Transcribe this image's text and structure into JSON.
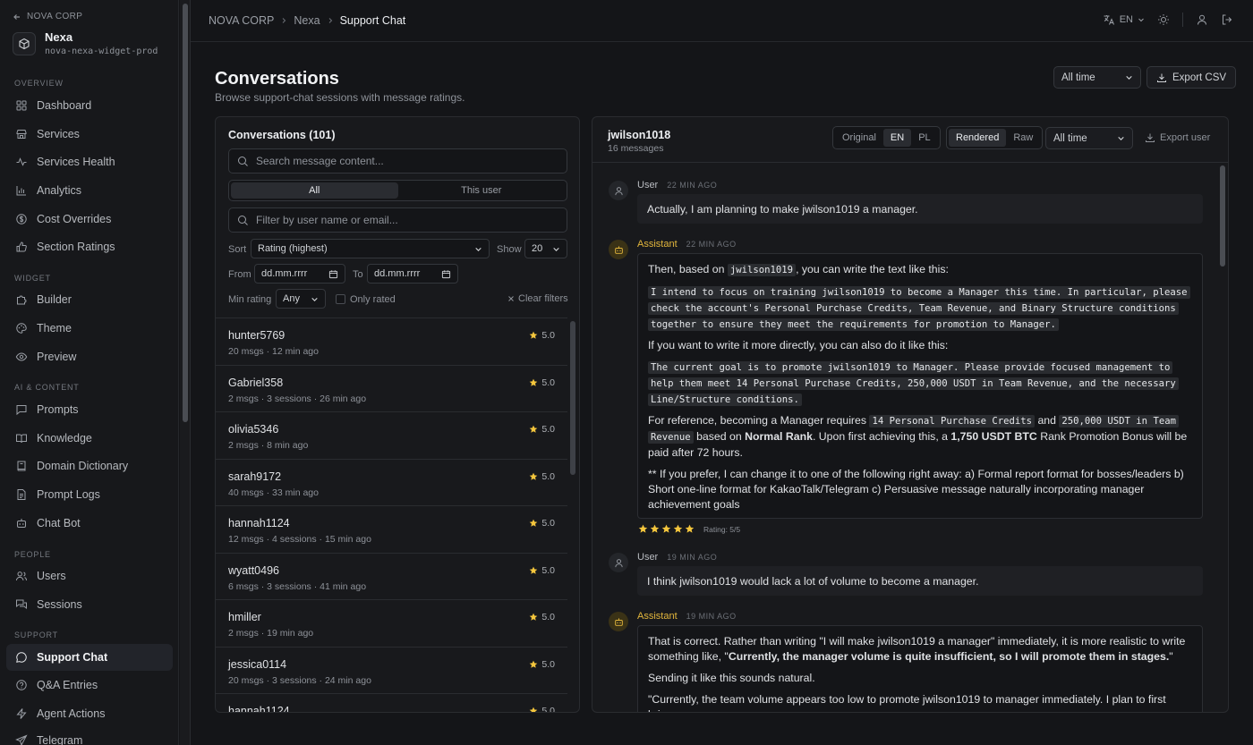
{
  "sidebar": {
    "back_label": "NOVA CORP",
    "project_name": "Nexa",
    "project_id": "nova-nexa-widget-prod",
    "sections": [
      {
        "title": "OVERVIEW",
        "items": [
          {
            "label": "Dashboard",
            "icon": "layout-grid-icon"
          },
          {
            "label": "Services",
            "icon": "store-icon"
          },
          {
            "label": "Services Health",
            "icon": "activity-icon"
          },
          {
            "label": "Analytics",
            "icon": "bar-chart-icon"
          },
          {
            "label": "Cost Overrides",
            "icon": "dollar-circle-icon"
          },
          {
            "label": "Section Ratings",
            "icon": "thumbs-up-icon"
          }
        ]
      },
      {
        "title": "WIDGET",
        "items": [
          {
            "label": "Builder",
            "icon": "puzzle-icon"
          },
          {
            "label": "Theme",
            "icon": "palette-icon"
          },
          {
            "label": "Preview",
            "icon": "eye-icon"
          }
        ]
      },
      {
        "title": "AI & CONTENT",
        "items": [
          {
            "label": "Prompts",
            "icon": "message-square-icon"
          },
          {
            "label": "Knowledge",
            "icon": "book-open-icon"
          },
          {
            "label": "Domain Dictionary",
            "icon": "book-icon"
          },
          {
            "label": "Prompt Logs",
            "icon": "file-text-icon"
          },
          {
            "label": "Chat Bot",
            "icon": "bot-icon"
          }
        ]
      },
      {
        "title": "PEOPLE",
        "items": [
          {
            "label": "Users",
            "icon": "users-icon"
          },
          {
            "label": "Sessions",
            "icon": "messages-icon"
          }
        ]
      },
      {
        "title": "SUPPORT",
        "items": [
          {
            "label": "Support Chat",
            "icon": "message-circle-icon",
            "active": true
          },
          {
            "label": "Q&A Entries",
            "icon": "help-circle-icon"
          },
          {
            "label": "Agent Actions",
            "icon": "zap-icon"
          },
          {
            "label": "Telegram",
            "icon": "send-icon"
          }
        ]
      }
    ]
  },
  "topbar": {
    "breadcrumb": [
      "NOVA CORP",
      "Nexa",
      "Support Chat"
    ],
    "language": "EN"
  },
  "page": {
    "title": "Conversations",
    "description": "Browse support-chat sessions with message ratings.",
    "time_filter": "All time",
    "export_label": "Export CSV"
  },
  "conversations": {
    "title": "Conversations (101)",
    "search_placeholder": "Search message content...",
    "scope_tabs": [
      "All",
      "This user"
    ],
    "user_filter_placeholder": "Filter by user name or email...",
    "sort_label": "Sort",
    "sort_value": "Rating (highest)",
    "show_label": "Show",
    "show_value": "20",
    "from_label": "From",
    "from_value": "dd.mm.rrrr",
    "to_label": "To",
    "to_value": "dd.mm.rrrr",
    "min_rating_label": "Min rating",
    "min_rating_value": "Any",
    "only_rated_label": "Only rated",
    "clear_label": "Clear filters",
    "items": [
      {
        "user": "hunter5769",
        "meta": "20 msgs · 12 min ago",
        "rating": "5.0"
      },
      {
        "user": "Gabriel358",
        "meta": "2 msgs · 3 sessions · 26 min ago",
        "rating": "5.0"
      },
      {
        "user": "olivia5346",
        "meta": "2 msgs · 8 min ago",
        "rating": "5.0"
      },
      {
        "user": "sarah9172",
        "meta": "40 msgs · 33 min ago",
        "rating": "5.0"
      },
      {
        "user": "hannah1124",
        "meta": "12 msgs · 4 sessions · 15 min ago",
        "rating": "5.0"
      },
      {
        "user": "wyatt0496",
        "meta": "6 msgs · 3 sessions · 41 min ago",
        "rating": "5.0"
      },
      {
        "user": "hmiller",
        "meta": "2 msgs · 19 min ago",
        "rating": "5.0"
      },
      {
        "user": "jessica0114",
        "meta": "20 msgs · 3 sessions · 24 min ago",
        "rating": "5.0"
      },
      {
        "user": "hannah1124",
        "meta": "",
        "rating": "5.0"
      }
    ]
  },
  "detail": {
    "user": "jwilson1018",
    "count": "16 messages",
    "lang_tabs": [
      "Original",
      "EN",
      "PL"
    ],
    "view_tabs": [
      "Rendered",
      "Raw"
    ],
    "time_filter": "All time",
    "export_label": "Export user",
    "messages": [
      {
        "role": "User",
        "time": "22 MIN AGO",
        "text": "Actually, I am planning to make jwilson1019 a manager."
      },
      {
        "role": "Assistant",
        "time": "22 MIN AGO",
        "p1a": "Then, based on ",
        "p1code": "jwilson1019",
        "p1b": ", you can write the text like this:",
        "code1": "I intend to focus on training jwilson1019 to become a Manager this time. In particular, please check the account's Personal Purchase Credits, Team Revenue, and Binary Structure conditions together to ensure they meet the requirements for promotion to Manager.",
        "p2": "If you want to write it more directly, you can also do it like this:",
        "code2": "The current goal is to promote jwilson1019 to Manager. Please provide focused management to help them meet 14 Personal Purchase Credits, 250,000 USDT in Team Revenue, and the necessary Line/Structure conditions.",
        "p3a": "For reference, becoming a Manager requires ",
        "p3c1": "14 Personal Purchase Credits",
        "p3b": " and ",
        "p3c2": "250,000 USDT in Team Revenue",
        "p3c": " based on ",
        "p3bold1": "Normal Rank",
        "p3d": ". Upon first achieving this, a ",
        "p3bold2": "1,750 USDT BTC",
        "p3e": " Rank Promotion Bonus will be paid after 72 hours.",
        "p4": "** If you prefer, I can change it to one of the following right away: a) Formal report format for bosses/leaders b) Short one-line format for KakaoTalk/Telegram c) Persuasive message naturally incorporating manager achievement goals",
        "rating": 5,
        "rating_label": "Rating: 5/5"
      },
      {
        "role": "User",
        "time": "19 MIN AGO",
        "text": "I think jwilson1019 would lack a lot of volume to become a manager."
      },
      {
        "role": "Assistant",
        "time": "19 MIN AGO",
        "p1a": "That is correct. Rather than writing \"I will make jwilson1019 a manager\" immediately, it is more realistic to write something like, \"",
        "p1bold": "Currently, the manager volume is quite insufficient, so I will promote them in stages.",
        "p1b": "\"",
        "p2": "Sending it like this sounds natural.",
        "p3": "\"Currently, the team volume appears too low to promote jwilson1019 to manager immediately. I plan to first bring"
      }
    ]
  },
  "colors": {
    "accent_star": "#f4c63d",
    "assistant_label": "#e2b63c",
    "background": "#141518"
  }
}
